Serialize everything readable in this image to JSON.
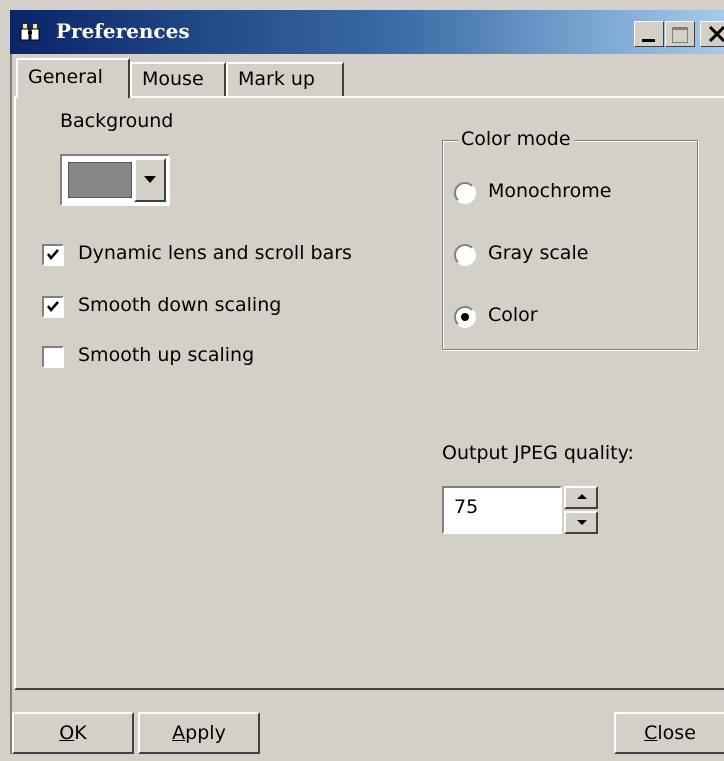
{
  "window": {
    "title": "Preferences",
    "title_icon": "binoculars-icon",
    "titlebar_colors": [
      "#0a246a",
      "#a6caf0"
    ]
  },
  "tabs": [
    {
      "label": "General",
      "active": true
    },
    {
      "label": "Mouse",
      "active": false
    },
    {
      "label": "Mark up",
      "active": false
    }
  ],
  "general": {
    "background_label": "Background",
    "background_color": "#868686",
    "checkboxes": [
      {
        "label": "Dynamic lens and scroll bars",
        "checked": true
      },
      {
        "label": "Smooth down scaling",
        "checked": true
      },
      {
        "label": "Smooth up scaling",
        "checked": false
      }
    ],
    "color_mode": {
      "legend": "Color mode",
      "options": [
        {
          "label": "Monochrome",
          "selected": false
        },
        {
          "label": "Gray scale",
          "selected": false
        },
        {
          "label": "Color",
          "selected": true
        }
      ]
    },
    "jpeg": {
      "label": "Output JPEG quality:",
      "value": "75"
    }
  },
  "buttons": {
    "ok": {
      "mnemonic": "O",
      "rest": "K"
    },
    "apply": {
      "mnemonic": "A",
      "rest": "pply"
    },
    "close": {
      "mnemonic": "C",
      "rest": "lose"
    }
  }
}
